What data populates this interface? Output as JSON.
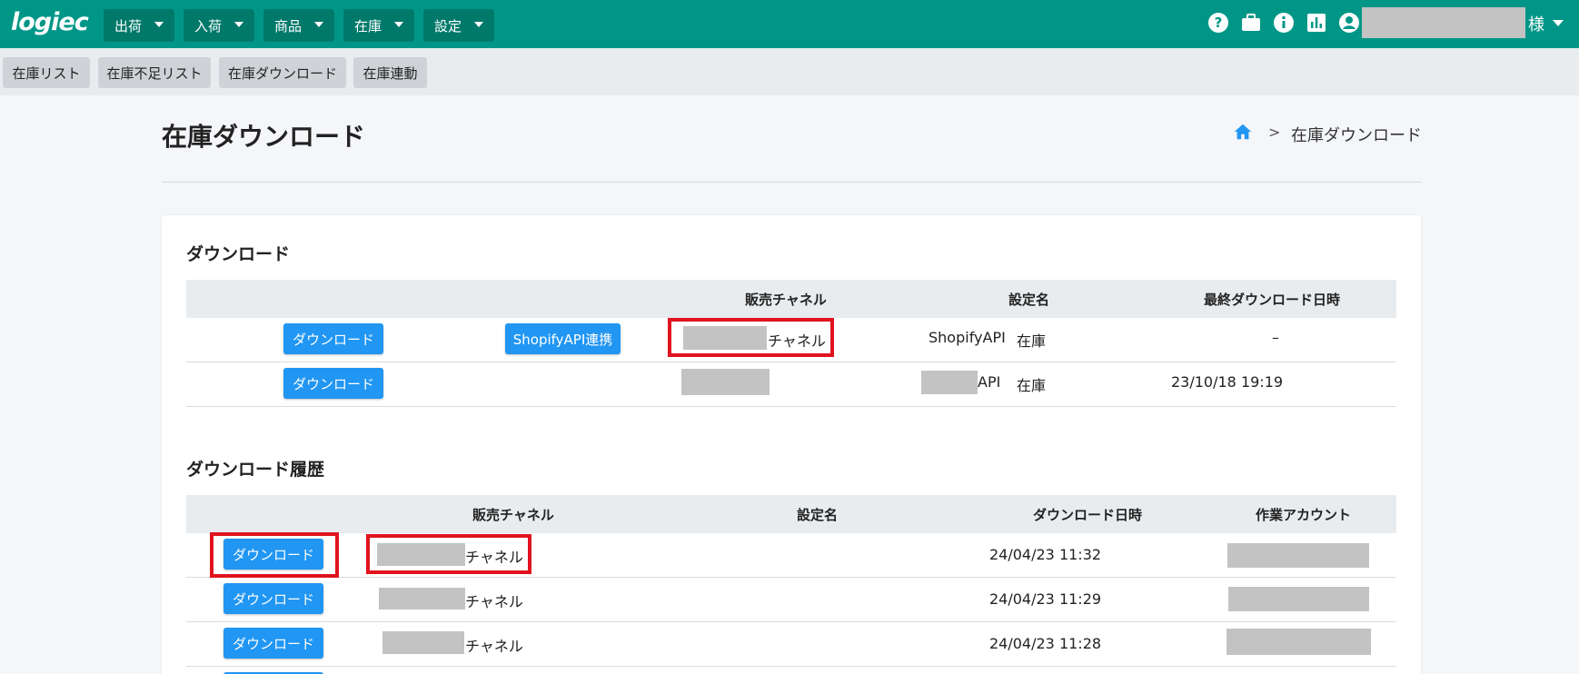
{
  "app": {
    "logo_text": "logiec",
    "user_suffix": "様"
  },
  "nav": {
    "menus": [
      "出荷",
      "入荷",
      "商品",
      "在庫",
      "設定"
    ]
  },
  "icons": {
    "help": "help-icon",
    "briefcase": "briefcase-icon",
    "info": "info-icon",
    "chart": "chart-icon",
    "account": "account-icon",
    "home": "home-icon"
  },
  "subnav": {
    "items": [
      "在庫リスト",
      "在庫不足リスト",
      "在庫ダウンロード",
      "在庫連動"
    ]
  },
  "page": {
    "title": "在庫ダウンロード",
    "breadcrumb_sep": ">",
    "breadcrumb_current": "在庫ダウンロード"
  },
  "download": {
    "section_title": "ダウンロード",
    "headers": {
      "channel": "販売チャネル",
      "setting": "設定名",
      "last_download": "最終ダウンロード日時"
    },
    "rows": [
      {
        "button": "ダウンロード",
        "api_button": "ShopifyAPI連携",
        "channel_suffix": "チャネル",
        "setting_main": "ShopifyAPI",
        "setting_sub": "在庫",
        "last_download": "–"
      },
      {
        "button": "ダウンロード",
        "channel_suffix": "",
        "setting_main": "API",
        "setting_sub": "在庫",
        "last_download": "23/10/18 19:19"
      }
    ]
  },
  "history": {
    "section_title": "ダウンロード履歴",
    "headers": {
      "channel": "販売チャネル",
      "setting": "設定名",
      "datetime": "ダウンロード日時",
      "account": "作業アカウント"
    },
    "rows": [
      {
        "button": "ダウンロード",
        "channel_suffix": "チャネル",
        "datetime": "24/04/23 11:32"
      },
      {
        "button": "ダウンロード",
        "channel_suffix": "チャネル",
        "datetime": "24/04/23 11:29"
      },
      {
        "button": "ダウンロード",
        "channel_suffix": "チャネル",
        "datetime": "24/04/23 11:28"
      }
    ]
  },
  "colors": {
    "header_bg": "#009687",
    "menu_bg": "#00796b",
    "primary_button": "#2196f3",
    "highlight_box": "#e0131f"
  }
}
